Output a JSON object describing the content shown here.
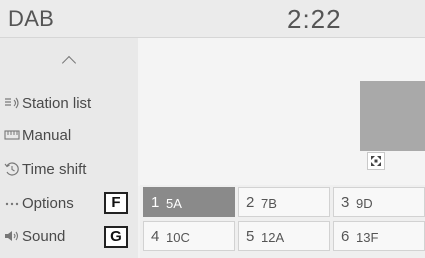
{
  "header": {
    "source_title": "DAB",
    "clock": "2:22"
  },
  "sidebar": {
    "collapse_icon": "chevron-up-icon",
    "items": [
      {
        "label": "Station list",
        "icon": "station-list-icon"
      },
      {
        "label": "Manual",
        "icon": "manual-tuning-icon"
      },
      {
        "label": "Time shift",
        "icon": "time-shift-icon"
      },
      {
        "label": "Options",
        "icon": "ellipsis-icon"
      },
      {
        "label": "Sound",
        "icon": "speaker-icon"
      }
    ]
  },
  "callouts": {
    "options": "F",
    "sound": "G"
  },
  "main": {
    "fullscreen_icon": "fullscreen-icon"
  },
  "presets": [
    {
      "num": "1",
      "channel": "5A",
      "active": true
    },
    {
      "num": "2",
      "channel": "7B",
      "active": false
    },
    {
      "num": "3",
      "channel": "9D",
      "active": false
    },
    {
      "num": "4",
      "channel": "10C",
      "active": false
    },
    {
      "num": "5",
      "channel": "12A",
      "active": false
    },
    {
      "num": "6",
      "channel": "13F",
      "active": false
    }
  ],
  "colors": {
    "active_preset": "#8a8a8a",
    "art_panel": "#a9a9a9",
    "sidebar_bg": "#e9e9e9"
  }
}
